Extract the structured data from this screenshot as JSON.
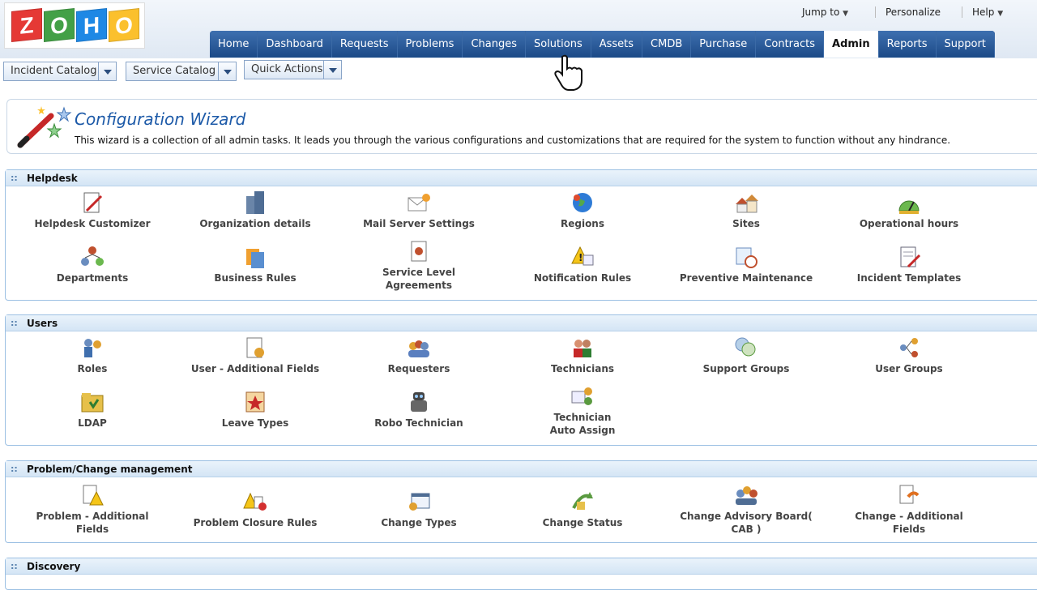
{
  "logo_letters": [
    "Z",
    "O",
    "H",
    "O"
  ],
  "toplinks": {
    "jump_to": "Jump to",
    "personalize": "Personalize",
    "help": "Help"
  },
  "nav": [
    "Home",
    "Dashboard",
    "Requests",
    "Problems",
    "Changes",
    "Solutions",
    "Assets",
    "CMDB",
    "Purchase",
    "Contracts",
    "Admin",
    "Reports",
    "Support"
  ],
  "nav_active": "Admin",
  "subbar": {
    "incident_catalog": "Incident Catalog",
    "service_catalog": "Service Catalog",
    "quick_actions": "Quick Actions"
  },
  "wizard": {
    "title": "Configuration Wizard",
    "description": "This wizard is a collection of all admin tasks. It leads you through the various configurations and customizations that are required for the system to function without any hindrance."
  },
  "sections": {
    "helpdesk": {
      "title": "Helpdesk",
      "items": [
        "Helpdesk Customizer",
        "Organization details",
        "Mail Server Settings",
        "Regions",
        "Sites",
        "Operational hours",
        "Departments",
        "Business Rules",
        "Service Level\nAgreements",
        "Notification Rules",
        "Preventive Maintenance",
        "Incident Templates"
      ]
    },
    "users": {
      "title": "Users",
      "items": [
        "Roles",
        "User - Additional Fields",
        "Requesters",
        "Technicians",
        "Support Groups",
        "User Groups",
        "LDAP",
        "Leave Types",
        "Robo Technician",
        "Technician\nAuto Assign"
      ]
    },
    "problem": {
      "title": "Problem/Change management",
      "items": [
        "Problem - Additional\nFields",
        "Problem Closure Rules",
        "Change Types",
        "Change Status",
        "Change Advisory Board(\nCAB )",
        "Change - Additional\nFields"
      ]
    },
    "discovery": {
      "title": "Discovery"
    }
  },
  "colors": {
    "nav": "#1e4f8c",
    "accent": "#1d5aa8",
    "section_border": "#9cc0e3"
  }
}
